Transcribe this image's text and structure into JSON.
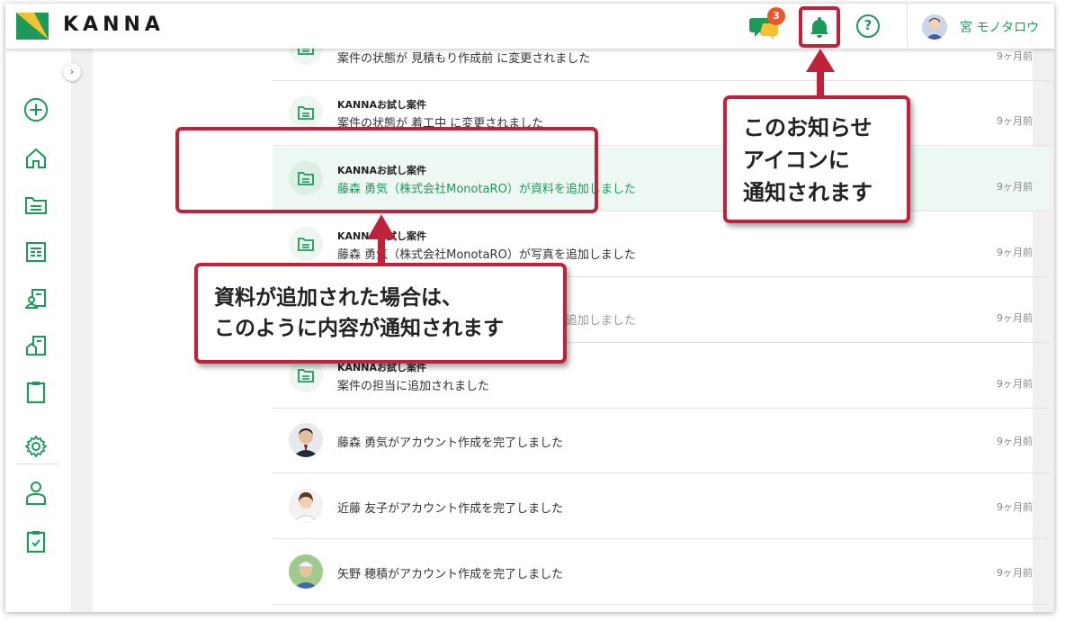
{
  "header": {
    "brand": "KANNA",
    "chat_badge": "3",
    "help_label": "?",
    "user_name": "宮 モノタロウ"
  },
  "notifications": [
    {
      "title": "",
      "text": "案件の状態が 見積もり作成前 に変更されました",
      "time": "9ヶ月前",
      "kind": "file"
    },
    {
      "title": "KANNAお試し案件",
      "text": "案件の状態が 着工中 に変更されました",
      "time": "9ヶ月前",
      "kind": "file"
    },
    {
      "title": "KANNAお試し案件",
      "text": "藤森 勇気（株式会社MonotaRO）が資料を追加しました",
      "time": "9ヶ月前",
      "kind": "file",
      "highlight": true
    },
    {
      "title": "KANNAお試し案件",
      "text": "藤森 勇気（株式会社MonotaRO）が写真を追加しました",
      "time": "9ヶ月前",
      "kind": "file"
    },
    {
      "title": "",
      "text": "藤森 勇気（株式会社MonotaRO）が資料を追加しました",
      "time": "9ヶ月前",
      "kind": "file"
    },
    {
      "title": "KANNAお試し案件",
      "text": "案件の担当に追加されました",
      "time": "9ヶ月前",
      "kind": "file"
    },
    {
      "title": "",
      "text": "藤森 勇気がアカウント作成を完了しました",
      "time": "9ヶ月前",
      "kind": "avatar"
    },
    {
      "title": "",
      "text": "近藤 友子がアカウント作成を完了しました",
      "time": "9ヶ月前",
      "kind": "avatar"
    },
    {
      "title": "",
      "text": "矢野 穂積がアカウント作成を完了しました",
      "time": "9ヶ月前",
      "kind": "avatar"
    }
  ],
  "callouts": {
    "bell_line1": "このお知らせ",
    "bell_line2": "アイコンに",
    "bell_line3": "通知されます",
    "doc_line1": "資料が追加された場合は、",
    "doc_line2": "このように内容が通知されます"
  },
  "colors": {
    "accent_green": "#1b9a5a",
    "annotation_red": "#c0223a",
    "badge_orange": "#e8572e"
  }
}
